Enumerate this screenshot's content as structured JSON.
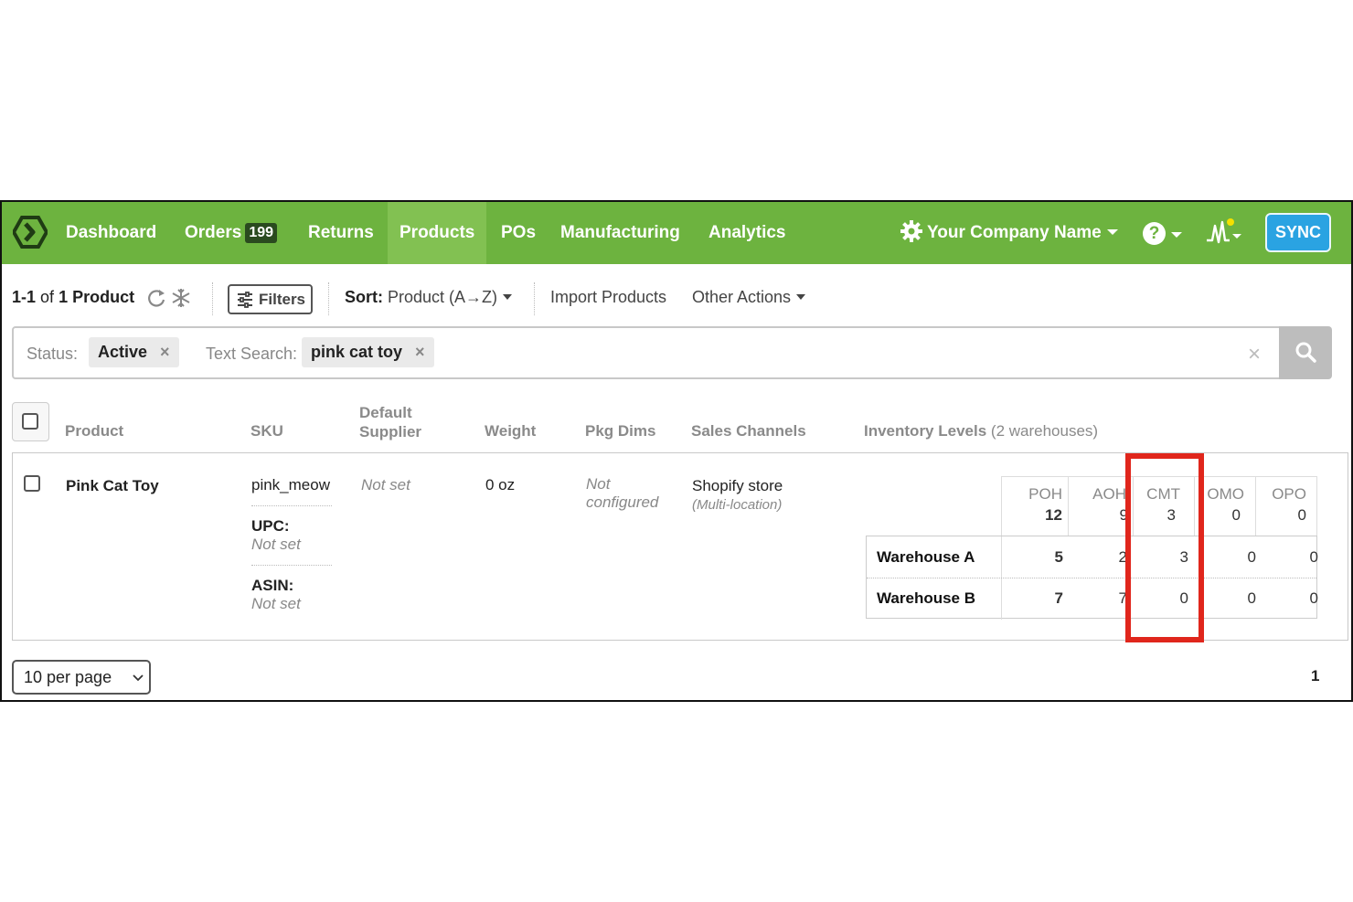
{
  "nav": {
    "items": [
      {
        "label": "Dashboard"
      },
      {
        "label": "Orders",
        "badge": "199"
      },
      {
        "label": "Returns"
      },
      {
        "label": "Products"
      },
      {
        "label": "POs"
      },
      {
        "label": "Manufacturing"
      },
      {
        "label": "Analytics"
      }
    ],
    "active": "Products",
    "company": "Your Company Name",
    "help": "?",
    "sync": "SYNC",
    "colors": {
      "bar": "#6db33f",
      "active": "#82c152",
      "sync": "#2aa3e2"
    }
  },
  "toolbar": {
    "range": "1-1",
    "of": "of",
    "count": "1 Product",
    "filters": "Filters",
    "sort_label": "Sort:",
    "sort_value": "Product (A→Z)",
    "import": "Import Products",
    "other_actions": "Other Actions"
  },
  "search": {
    "status_label": "Status:",
    "status_value": "Active",
    "text_label": "Text Search:",
    "text_value": "pink cat toy",
    "remove": "×",
    "clear": "×"
  },
  "table": {
    "headers": {
      "product": "Product",
      "sku": "SKU",
      "supplier_1": "Default",
      "supplier_2": "Supplier",
      "weight": "Weight",
      "pkg_dims": "Pkg Dims",
      "sales_channels": "Sales Channels",
      "inventory": "Inventory Levels",
      "inventory_note": "(2 warehouses)"
    },
    "row": {
      "product": "Pink Cat Toy",
      "sku": "pink_meow",
      "upc_label": "UPC:",
      "upc_value": "Not set",
      "asin_label": "ASIN:",
      "asin_value": "Not set",
      "supplier": "Not set",
      "weight": "0 oz",
      "pkg_dims_1": "Not",
      "pkg_dims_2": "configured",
      "channel": "Shopify store",
      "channel_note": "(Multi-location)"
    },
    "inventory": {
      "columns": [
        "POH",
        "AOH",
        "CMT",
        "OMO",
        "OPO"
      ],
      "totals": [
        "12",
        "9",
        "3",
        "0",
        "0"
      ],
      "warehouses": [
        {
          "name": "Warehouse A",
          "values": [
            "5",
            "2",
            "3",
            "0",
            "0"
          ]
        },
        {
          "name": "Warehouse B",
          "values": [
            "7",
            "7",
            "0",
            "0",
            "0"
          ]
        }
      ],
      "highlighted_column": "CMT",
      "highlight_color": "#e0261c"
    }
  },
  "footer": {
    "per_page": "10 per page",
    "page": "1"
  }
}
